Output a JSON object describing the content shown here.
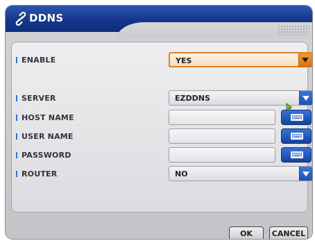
{
  "window": {
    "title": "DDNS",
    "title_icon": "ddns-link-icon"
  },
  "fields": {
    "enable": {
      "label": "ENABLE",
      "value": "YES"
    },
    "server": {
      "label": "SERVER",
      "value": "EZDDNS"
    },
    "host": {
      "label": "HOST NAME",
      "value": "",
      "button_icon": "keyboard-icon"
    },
    "user": {
      "label": "USER NAME",
      "value": "",
      "button_icon": "keyboard-icon"
    },
    "password": {
      "label": "PASSWORD",
      "value": "",
      "button_icon": "keyboard-icon"
    },
    "router": {
      "label": "ROUTER",
      "value": "NO"
    }
  },
  "buttons": {
    "ok": "OK",
    "cancel": "CANCEL"
  },
  "colors": {
    "title_bar": "#1a3f95",
    "focus_accent": "#e08020",
    "dropdown_arrow": "#2a66cc"
  }
}
